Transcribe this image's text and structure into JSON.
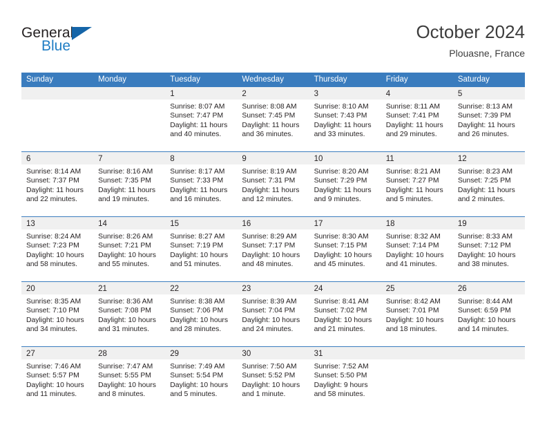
{
  "brand": {
    "name_part1": "General",
    "name_part2": "Blue",
    "triangle_icon": "brand-triangle-icon",
    "color_dark": "#231f20",
    "color_blue": "#1f7dc4"
  },
  "header": {
    "title": "October 2024",
    "subtitle": "Plouasne, France"
  },
  "theme": {
    "header_blue": "#3a7cbe",
    "band_gray": "#f0f0f0",
    "text": "#231f20"
  },
  "weekdays": [
    "Sunday",
    "Monday",
    "Tuesday",
    "Wednesday",
    "Thursday",
    "Friday",
    "Saturday"
  ],
  "weeks": [
    [
      {
        "day": "",
        "sunrise": "",
        "sunset": "",
        "daylight_line1": "",
        "daylight_line2": ""
      },
      {
        "day": "",
        "sunrise": "",
        "sunset": "",
        "daylight_line1": "",
        "daylight_line2": ""
      },
      {
        "day": "1",
        "sunrise": "Sunrise: 8:07 AM",
        "sunset": "Sunset: 7:47 PM",
        "daylight_line1": "Daylight: 11 hours",
        "daylight_line2": "and 40 minutes."
      },
      {
        "day": "2",
        "sunrise": "Sunrise: 8:08 AM",
        "sunset": "Sunset: 7:45 PM",
        "daylight_line1": "Daylight: 11 hours",
        "daylight_line2": "and 36 minutes."
      },
      {
        "day": "3",
        "sunrise": "Sunrise: 8:10 AM",
        "sunset": "Sunset: 7:43 PM",
        "daylight_line1": "Daylight: 11 hours",
        "daylight_line2": "and 33 minutes."
      },
      {
        "day": "4",
        "sunrise": "Sunrise: 8:11 AM",
        "sunset": "Sunset: 7:41 PM",
        "daylight_line1": "Daylight: 11 hours",
        "daylight_line2": "and 29 minutes."
      },
      {
        "day": "5",
        "sunrise": "Sunrise: 8:13 AM",
        "sunset": "Sunset: 7:39 PM",
        "daylight_line1": "Daylight: 11 hours",
        "daylight_line2": "and 26 minutes."
      }
    ],
    [
      {
        "day": "6",
        "sunrise": "Sunrise: 8:14 AM",
        "sunset": "Sunset: 7:37 PM",
        "daylight_line1": "Daylight: 11 hours",
        "daylight_line2": "and 22 minutes."
      },
      {
        "day": "7",
        "sunrise": "Sunrise: 8:16 AM",
        "sunset": "Sunset: 7:35 PM",
        "daylight_line1": "Daylight: 11 hours",
        "daylight_line2": "and 19 minutes."
      },
      {
        "day": "8",
        "sunrise": "Sunrise: 8:17 AM",
        "sunset": "Sunset: 7:33 PM",
        "daylight_line1": "Daylight: 11 hours",
        "daylight_line2": "and 16 minutes."
      },
      {
        "day": "9",
        "sunrise": "Sunrise: 8:19 AM",
        "sunset": "Sunset: 7:31 PM",
        "daylight_line1": "Daylight: 11 hours",
        "daylight_line2": "and 12 minutes."
      },
      {
        "day": "10",
        "sunrise": "Sunrise: 8:20 AM",
        "sunset": "Sunset: 7:29 PM",
        "daylight_line1": "Daylight: 11 hours",
        "daylight_line2": "and 9 minutes."
      },
      {
        "day": "11",
        "sunrise": "Sunrise: 8:21 AM",
        "sunset": "Sunset: 7:27 PM",
        "daylight_line1": "Daylight: 11 hours",
        "daylight_line2": "and 5 minutes."
      },
      {
        "day": "12",
        "sunrise": "Sunrise: 8:23 AM",
        "sunset": "Sunset: 7:25 PM",
        "daylight_line1": "Daylight: 11 hours",
        "daylight_line2": "and 2 minutes."
      }
    ],
    [
      {
        "day": "13",
        "sunrise": "Sunrise: 8:24 AM",
        "sunset": "Sunset: 7:23 PM",
        "daylight_line1": "Daylight: 10 hours",
        "daylight_line2": "and 58 minutes."
      },
      {
        "day": "14",
        "sunrise": "Sunrise: 8:26 AM",
        "sunset": "Sunset: 7:21 PM",
        "daylight_line1": "Daylight: 10 hours",
        "daylight_line2": "and 55 minutes."
      },
      {
        "day": "15",
        "sunrise": "Sunrise: 8:27 AM",
        "sunset": "Sunset: 7:19 PM",
        "daylight_line1": "Daylight: 10 hours",
        "daylight_line2": "and 51 minutes."
      },
      {
        "day": "16",
        "sunrise": "Sunrise: 8:29 AM",
        "sunset": "Sunset: 7:17 PM",
        "daylight_line1": "Daylight: 10 hours",
        "daylight_line2": "and 48 minutes."
      },
      {
        "day": "17",
        "sunrise": "Sunrise: 8:30 AM",
        "sunset": "Sunset: 7:15 PM",
        "daylight_line1": "Daylight: 10 hours",
        "daylight_line2": "and 45 minutes."
      },
      {
        "day": "18",
        "sunrise": "Sunrise: 8:32 AM",
        "sunset": "Sunset: 7:14 PM",
        "daylight_line1": "Daylight: 10 hours",
        "daylight_line2": "and 41 minutes."
      },
      {
        "day": "19",
        "sunrise": "Sunrise: 8:33 AM",
        "sunset": "Sunset: 7:12 PM",
        "daylight_line1": "Daylight: 10 hours",
        "daylight_line2": "and 38 minutes."
      }
    ],
    [
      {
        "day": "20",
        "sunrise": "Sunrise: 8:35 AM",
        "sunset": "Sunset: 7:10 PM",
        "daylight_line1": "Daylight: 10 hours",
        "daylight_line2": "and 34 minutes."
      },
      {
        "day": "21",
        "sunrise": "Sunrise: 8:36 AM",
        "sunset": "Sunset: 7:08 PM",
        "daylight_line1": "Daylight: 10 hours",
        "daylight_line2": "and 31 minutes."
      },
      {
        "day": "22",
        "sunrise": "Sunrise: 8:38 AM",
        "sunset": "Sunset: 7:06 PM",
        "daylight_line1": "Daylight: 10 hours",
        "daylight_line2": "and 28 minutes."
      },
      {
        "day": "23",
        "sunrise": "Sunrise: 8:39 AM",
        "sunset": "Sunset: 7:04 PM",
        "daylight_line1": "Daylight: 10 hours",
        "daylight_line2": "and 24 minutes."
      },
      {
        "day": "24",
        "sunrise": "Sunrise: 8:41 AM",
        "sunset": "Sunset: 7:02 PM",
        "daylight_line1": "Daylight: 10 hours",
        "daylight_line2": "and 21 minutes."
      },
      {
        "day": "25",
        "sunrise": "Sunrise: 8:42 AM",
        "sunset": "Sunset: 7:01 PM",
        "daylight_line1": "Daylight: 10 hours",
        "daylight_line2": "and 18 minutes."
      },
      {
        "day": "26",
        "sunrise": "Sunrise: 8:44 AM",
        "sunset": "Sunset: 6:59 PM",
        "daylight_line1": "Daylight: 10 hours",
        "daylight_line2": "and 14 minutes."
      }
    ],
    [
      {
        "day": "27",
        "sunrise": "Sunrise: 7:46 AM",
        "sunset": "Sunset: 5:57 PM",
        "daylight_line1": "Daylight: 10 hours",
        "daylight_line2": "and 11 minutes."
      },
      {
        "day": "28",
        "sunrise": "Sunrise: 7:47 AM",
        "sunset": "Sunset: 5:55 PM",
        "daylight_line1": "Daylight: 10 hours",
        "daylight_line2": "and 8 minutes."
      },
      {
        "day": "29",
        "sunrise": "Sunrise: 7:49 AM",
        "sunset": "Sunset: 5:54 PM",
        "daylight_line1": "Daylight: 10 hours",
        "daylight_line2": "and 5 minutes."
      },
      {
        "day": "30",
        "sunrise": "Sunrise: 7:50 AM",
        "sunset": "Sunset: 5:52 PM",
        "daylight_line1": "Daylight: 10 hours",
        "daylight_line2": "and 1 minute."
      },
      {
        "day": "31",
        "sunrise": "Sunrise: 7:52 AM",
        "sunset": "Sunset: 5:50 PM",
        "daylight_line1": "Daylight: 9 hours",
        "daylight_line2": "and 58 minutes."
      },
      {
        "day": "",
        "sunrise": "",
        "sunset": "",
        "daylight_line1": "",
        "daylight_line2": ""
      },
      {
        "day": "",
        "sunrise": "",
        "sunset": "",
        "daylight_line1": "",
        "daylight_line2": ""
      }
    ]
  ]
}
